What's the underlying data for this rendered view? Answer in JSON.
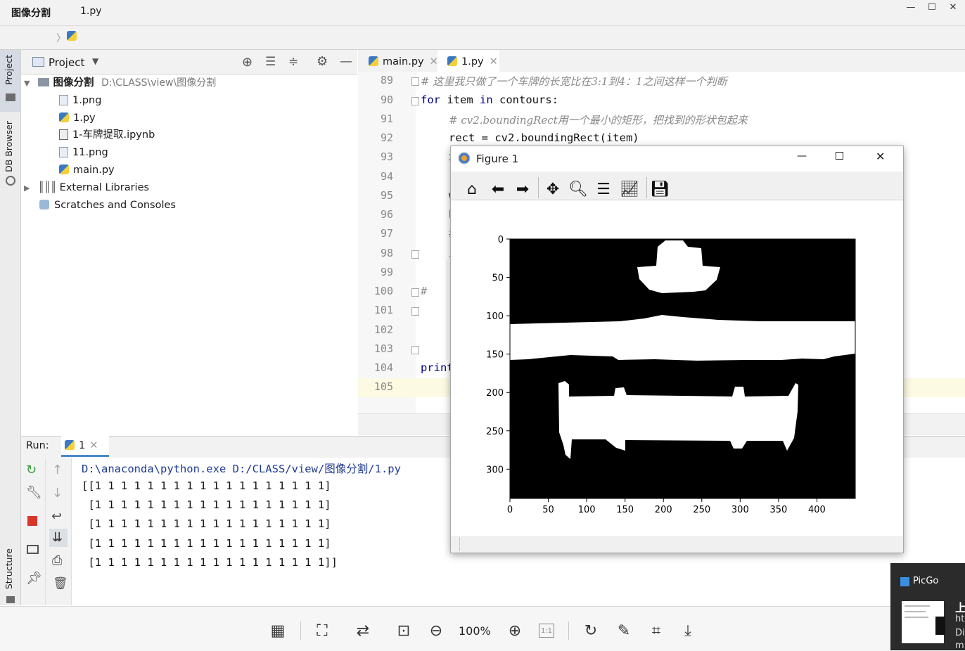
{
  "window": {
    "controls": [
      "—",
      "☐",
      "✕"
    ]
  },
  "breadcrumb": {
    "project": "图像分割",
    "file": "1.py"
  },
  "left_strip": {
    "tabs": [
      "Project",
      "DB Browser",
      "Structure"
    ]
  },
  "project_panel": {
    "header": "Project",
    "tree": [
      {
        "label": "图像分割",
        "path": "D:\\CLASS\\view\\图像分割",
        "kind": "folder"
      },
      {
        "label": "1.png",
        "kind": "image"
      },
      {
        "label": "1.py",
        "kind": "python"
      },
      {
        "label": "1-车牌提取.ipynb",
        "kind": "notebook"
      },
      {
        "label": "11.png",
        "kind": "image"
      },
      {
        "label": "main.py",
        "kind": "python"
      },
      {
        "label": "External Libraries",
        "kind": "library"
      },
      {
        "label": "Scratches and Consoles",
        "kind": "scratch"
      }
    ]
  },
  "editor": {
    "tabs": [
      {
        "label": "main.py"
      },
      {
        "label": "1.py"
      }
    ],
    "line_numbers": [
      "89",
      "90",
      "91",
      "92",
      "93",
      "94",
      "95",
      "96",
      "97",
      "98",
      "99",
      "100",
      "101",
      "102",
      "103",
      "104",
      "105"
    ],
    "lines": {
      "l89": "# 这里我只做了一个车牌的长宽比在3:1到4：1之间这样一个判断",
      "l90_kw1": "for",
      "l90_mid": " item ",
      "l90_kw2": "in",
      "l90_end": " contours:",
      "l91": "# cv2.boundingRect用一个最小的矩形，把找到的形状包起来",
      "l92": "rect = cv2.boundingRect(item)",
      "l93": "x",
      "l95": "w",
      "l96": "h",
      "l97": "#",
      "l98": "i",
      "l100": "#",
      "l104": "print"
    }
  },
  "run": {
    "label": "Run:",
    "tab": "1",
    "console": [
      "D:\\anaconda\\python.exe D:/CLASS/view/图像分割/1.py",
      "[[1 1 1 1 1 1 1 1 1 1 1 1 1 1 1 1 1 1]",
      " [1 1 1 1 1 1 1 1 1 1 1 1 1 1 1 1 1 1]",
      " [1 1 1 1 1 1 1 1 1 1 1 1 1 1 1 1 1 1]",
      " [1 1 1 1 1 1 1 1 1 1 1 1 1 1 1 1 1 1]",
      " [1 1 1 1 1 1 1 1 1 1 1 1 1 1 1 1 1 1]]"
    ]
  },
  "figure": {
    "title": "Figure 1",
    "toolbar": [
      "home-icon",
      "back-icon",
      "forward-icon",
      "pan-icon",
      "zoom-icon",
      "configure-icon",
      "axes-icon",
      "save-icon"
    ],
    "x_ticks": [
      "0",
      "50",
      "100",
      "150",
      "200",
      "250",
      "300",
      "350",
      "400"
    ],
    "y_ticks": [
      "0",
      "50",
      "100",
      "150",
      "200",
      "250",
      "300"
    ]
  },
  "viewer_bar": {
    "zoom": "100%",
    "one_to_one": "1:1"
  },
  "picgo": {
    "title": "PicGo",
    "line1": "上",
    "line2": "ht",
    "line3": "Di",
    "line4": "m"
  }
}
